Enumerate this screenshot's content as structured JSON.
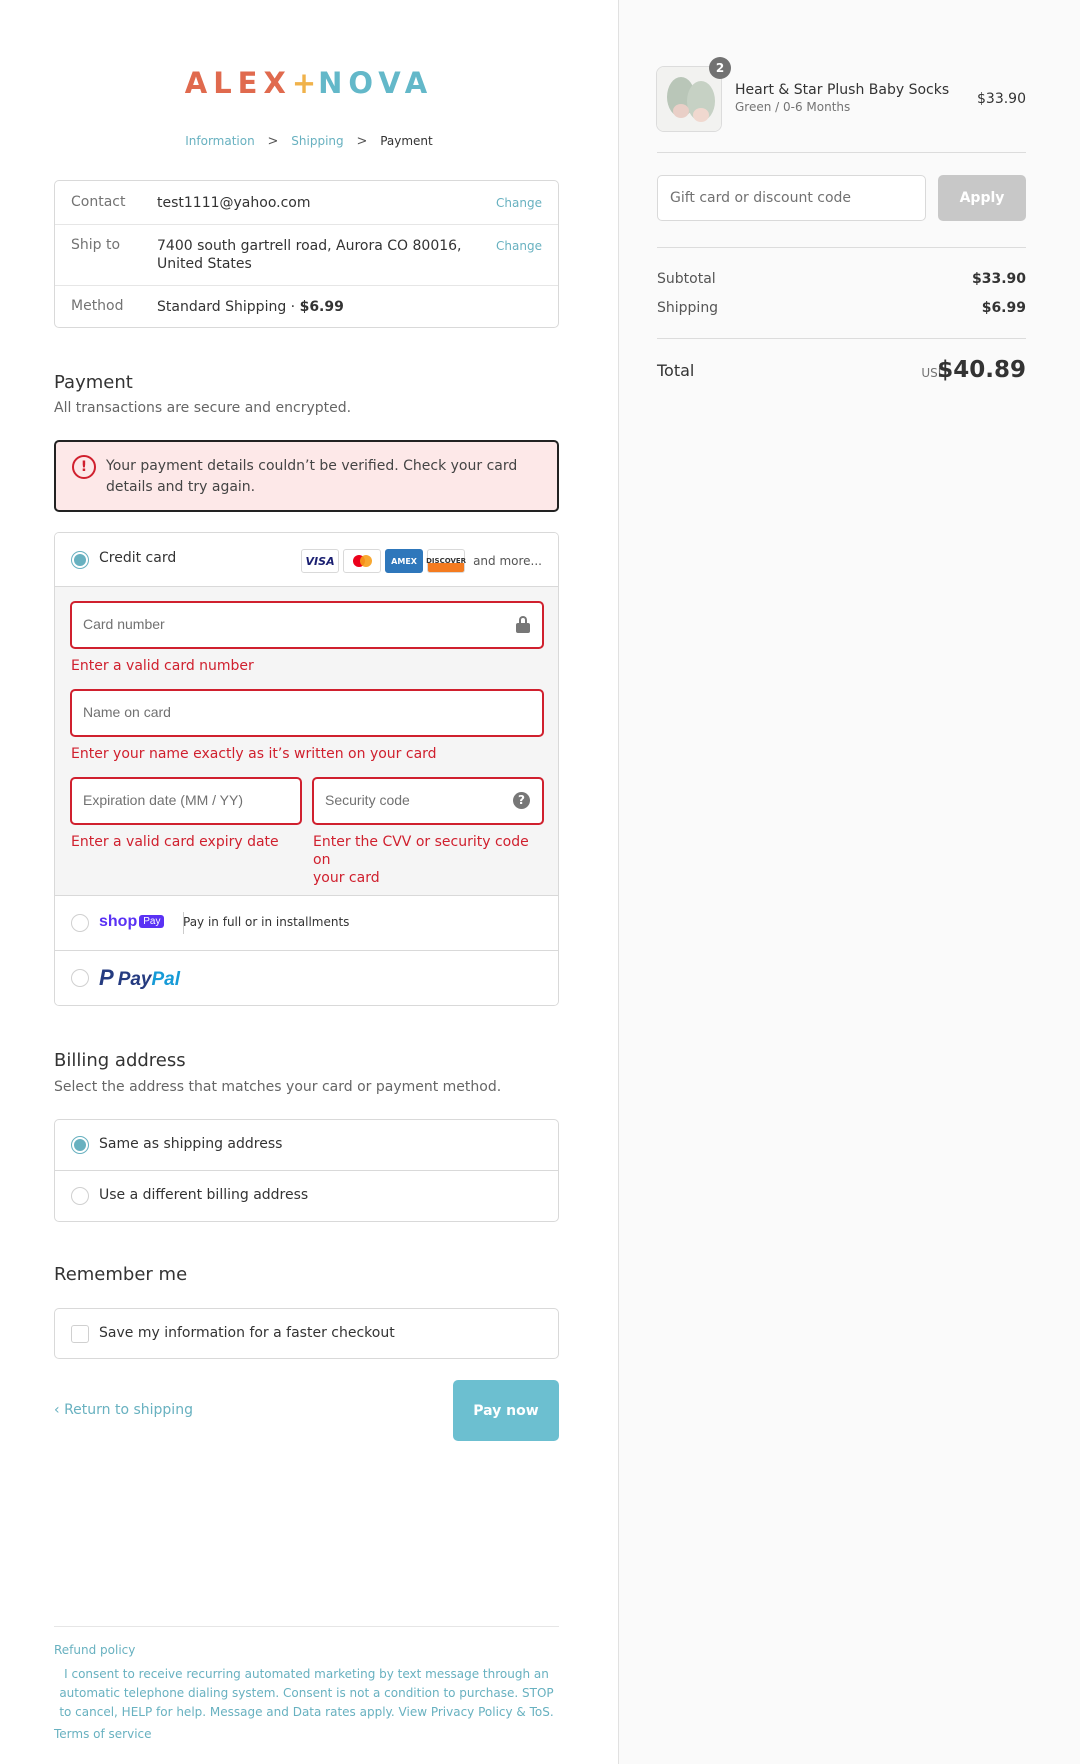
{
  "brand": {
    "part1": "ALEX",
    "plus": "+",
    "part2": "NOVA"
  },
  "breadcrumb": {
    "items": [
      "Information",
      "Shipping",
      "Payment"
    ],
    "separator": ">"
  },
  "review": {
    "contact_label": "Contact",
    "contact_value": "test1111@yahoo.com",
    "shipto_label": "Ship to",
    "shipto_value_line1": "7400 south gartrell road, Aurora CO 80016,",
    "shipto_value_line2": "United States",
    "method_label": "Method",
    "method_value": "Standard Shipping · ",
    "method_price": "$6.99",
    "change_label": "Change"
  },
  "payment": {
    "title": "Payment",
    "subtitle": "All transactions are secure and encrypted.",
    "error_line1": "Your payment details couldn’t be verified. Check your card",
    "error_line2": "details and try again.",
    "credit_card_label": "Credit card",
    "card_brands": [
      "VISA",
      "Mastercard",
      "AMEX",
      "DISCOVER"
    ],
    "and_more": "and more...",
    "card_number_placeholder": "Card number",
    "card_number_error": "Enter a valid card number",
    "name_placeholder": "Name on card",
    "name_error": "Enter your name exactly as it’s written on your card",
    "expiry_placeholder": "Expiration date (MM / YY)",
    "expiry_error": "Enter a valid card expiry date",
    "cvv_placeholder": "Security code",
    "cvv_error_line1": "Enter the CVV or security code on",
    "cvv_error_line2": "your card",
    "shoppay_logo": "shop",
    "shoppay_badge": "Pay",
    "shoppay_text": "Pay in full or in installments",
    "paypal_part1": "Pay",
    "paypal_part2": "Pal"
  },
  "billing": {
    "title": "Billing address",
    "subtitle": "Select the address that matches your card or payment method.",
    "same_label": "Same as shipping address",
    "different_label": "Use a different billing address"
  },
  "remember": {
    "title": "Remember me",
    "save_label": "Save my information for a faster checkout"
  },
  "actions": {
    "return_label": "Return to shipping",
    "paynow_label": "Pay now"
  },
  "footer": {
    "refund": "Refund policy",
    "consent": "I consent to receive recurring automated marketing by text message through an automatic telephone dialing system. Consent is not a condition to purchase. STOP to cancel, HELP for help. Message and Data rates apply. View Privacy Policy & ToS.",
    "terms": "Terms of service"
  },
  "summary": {
    "product_name": "Heart & Star Plush Baby Socks",
    "product_variant": "Green / 0-6 Months",
    "product_price": "$33.90",
    "quantity": "2",
    "gift_placeholder": "Gift card or discount code",
    "apply_label": "Apply",
    "subtotal_label": "Subtotal",
    "subtotal_value": "$33.90",
    "shipping_label": "Shipping",
    "shipping_value": "$6.99",
    "total_label": "Total",
    "total_currency": "USD",
    "total_value": "$40.89"
  },
  "colors": {
    "accent": "#68b1c0",
    "error": "#d0202e",
    "paynow": "#6cbfd0",
    "brand_alex": "#e06a4e",
    "brand_nova": "#63b8c9",
    "brand_plus": "#f0b24a"
  }
}
